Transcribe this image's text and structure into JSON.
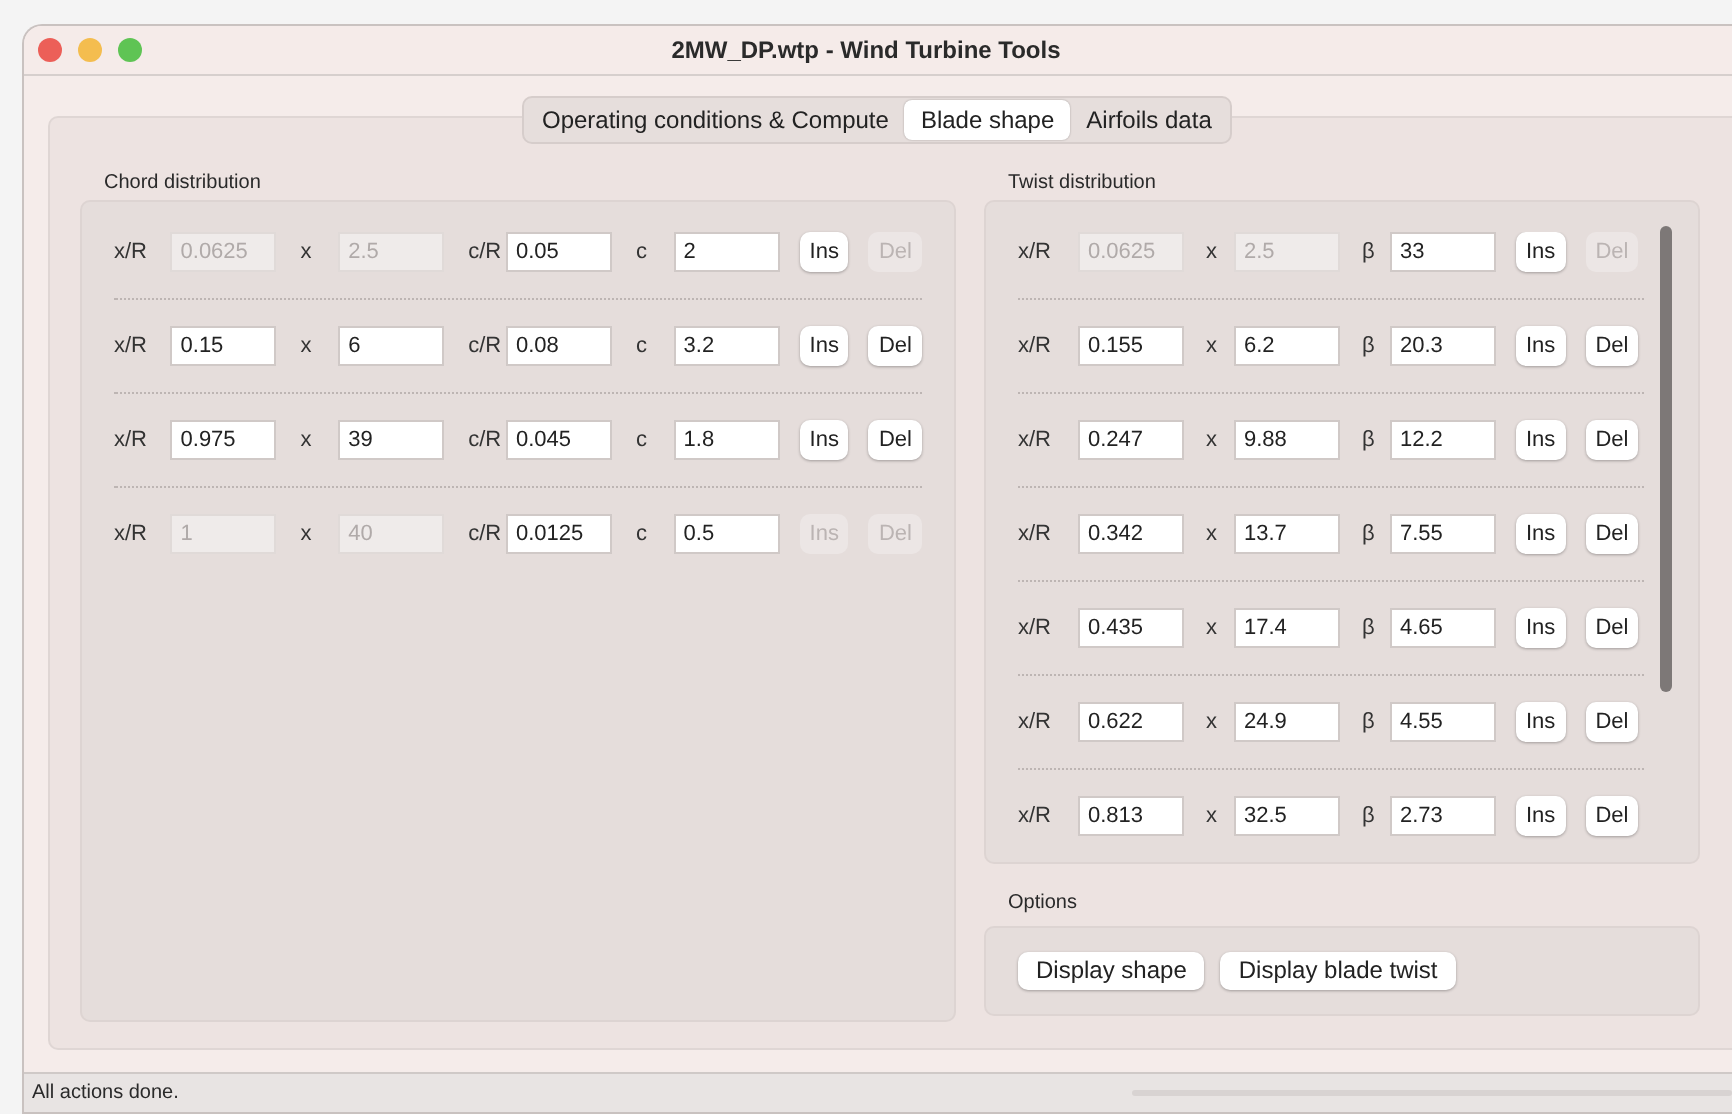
{
  "window": {
    "title": "2MW_DP.wtp - Wind Turbine Tools"
  },
  "tabs": [
    {
      "label": "Operating conditions & Compute",
      "selected": false
    },
    {
      "label": "Blade shape",
      "selected": true
    },
    {
      "label": "Airfoils data",
      "selected": false
    }
  ],
  "chord_distribution": {
    "title": "Chord distribution",
    "rows": [
      {
        "fields": [
          {
            "label": "x/R",
            "value": "0.0625",
            "disabled": true
          },
          {
            "label": "x",
            "value": "2.5",
            "disabled": true
          },
          {
            "label": "c/R",
            "value": "0.05",
            "disabled": false
          },
          {
            "label": "c",
            "value": "2",
            "disabled": false
          }
        ],
        "buttons": [
          {
            "label": "Ins",
            "disabled": false
          },
          {
            "label": "Del",
            "disabled": true
          }
        ]
      },
      {
        "fields": [
          {
            "label": "x/R",
            "value": "0.15",
            "disabled": false
          },
          {
            "label": "x",
            "value": "6",
            "disabled": false
          },
          {
            "label": "c/R",
            "value": "0.08",
            "disabled": false
          },
          {
            "label": "c",
            "value": "3.2",
            "disabled": false
          }
        ],
        "buttons": [
          {
            "label": "Ins",
            "disabled": false
          },
          {
            "label": "Del",
            "disabled": false
          }
        ]
      },
      {
        "fields": [
          {
            "label": "x/R",
            "value": "0.975",
            "disabled": false
          },
          {
            "label": "x",
            "value": "39",
            "disabled": false
          },
          {
            "label": "c/R",
            "value": "0.045",
            "disabled": false
          },
          {
            "label": "c",
            "value": "1.8",
            "disabled": false
          }
        ],
        "buttons": [
          {
            "label": "Ins",
            "disabled": false
          },
          {
            "label": "Del",
            "disabled": false
          }
        ]
      },
      {
        "fields": [
          {
            "label": "x/R",
            "value": "1",
            "disabled": true
          },
          {
            "label": "x",
            "value": "40",
            "disabled": true
          },
          {
            "label": "c/R",
            "value": "0.0125",
            "disabled": false
          },
          {
            "label": "c",
            "value": "0.5",
            "disabled": false
          }
        ],
        "buttons": [
          {
            "label": "Ins",
            "disabled": true
          },
          {
            "label": "Del",
            "disabled": true
          }
        ]
      }
    ]
  },
  "twist_distribution": {
    "title": "Twist distribution",
    "rows": [
      {
        "fields": [
          {
            "label": "x/R",
            "value": "0.0625",
            "disabled": true
          },
          {
            "label": "x",
            "value": "2.5",
            "disabled": true
          },
          {
            "label": "β",
            "value": "33",
            "disabled": false
          }
        ],
        "buttons": [
          {
            "label": "Ins",
            "disabled": false
          },
          {
            "label": "Del",
            "disabled": true
          }
        ]
      },
      {
        "fields": [
          {
            "label": "x/R",
            "value": "0.155",
            "disabled": false
          },
          {
            "label": "x",
            "value": "6.2",
            "disabled": false
          },
          {
            "label": "β",
            "value": "20.3",
            "disabled": false
          }
        ],
        "buttons": [
          {
            "label": "Ins",
            "disabled": false
          },
          {
            "label": "Del",
            "disabled": false
          }
        ]
      },
      {
        "fields": [
          {
            "label": "x/R",
            "value": "0.247",
            "disabled": false
          },
          {
            "label": "x",
            "value": "9.88",
            "disabled": false
          },
          {
            "label": "β",
            "value": "12.2",
            "disabled": false
          }
        ],
        "buttons": [
          {
            "label": "Ins",
            "disabled": false
          },
          {
            "label": "Del",
            "disabled": false
          }
        ]
      },
      {
        "fields": [
          {
            "label": "x/R",
            "value": "0.342",
            "disabled": false
          },
          {
            "label": "x",
            "value": "13.7",
            "disabled": false
          },
          {
            "label": "β",
            "value": "7.55",
            "disabled": false
          }
        ],
        "buttons": [
          {
            "label": "Ins",
            "disabled": false
          },
          {
            "label": "Del",
            "disabled": false
          }
        ]
      },
      {
        "fields": [
          {
            "label": "x/R",
            "value": "0.435",
            "disabled": false
          },
          {
            "label": "x",
            "value": "17.4",
            "disabled": false
          },
          {
            "label": "β",
            "value": "4.65",
            "disabled": false
          }
        ],
        "buttons": [
          {
            "label": "Ins",
            "disabled": false
          },
          {
            "label": "Del",
            "disabled": false
          }
        ]
      },
      {
        "fields": [
          {
            "label": "x/R",
            "value": "0.622",
            "disabled": false
          },
          {
            "label": "x",
            "value": "24.9",
            "disabled": false
          },
          {
            "label": "β",
            "value": "4.55",
            "disabled": false
          }
        ],
        "buttons": [
          {
            "label": "Ins",
            "disabled": false
          },
          {
            "label": "Del",
            "disabled": false
          }
        ]
      },
      {
        "fields": [
          {
            "label": "x/R",
            "value": "0.813",
            "disabled": false
          },
          {
            "label": "x",
            "value": "32.5",
            "disabled": false
          },
          {
            "label": "β",
            "value": "2.73",
            "disabled": false
          }
        ],
        "buttons": [
          {
            "label": "Ins",
            "disabled": false
          },
          {
            "label": "Del",
            "disabled": false
          }
        ]
      }
    ]
  },
  "options": {
    "title": "Options",
    "buttons": [
      "Display shape",
      "Display blade twist"
    ]
  },
  "status_bar": {
    "text": "All actions done."
  }
}
